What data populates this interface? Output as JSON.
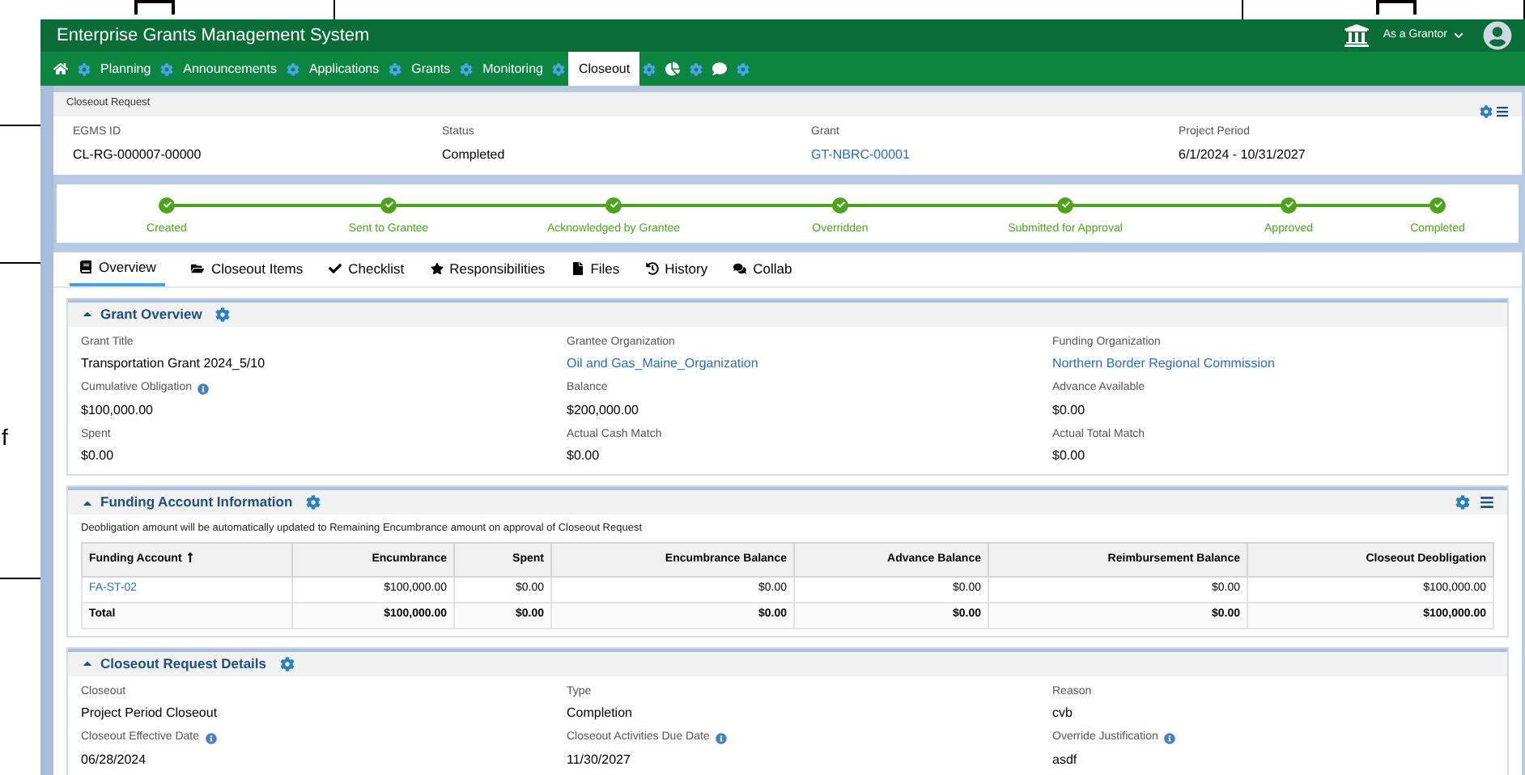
{
  "page_margin": {
    "letter": "f"
  },
  "header": {
    "title": "Enterprise Grants Management System",
    "role_menu": "As a Grantor"
  },
  "nav": [
    {
      "kind": "home"
    },
    {
      "kind": "tab",
      "label": "Planning",
      "selected": false
    },
    {
      "kind": "tab",
      "label": "Announcements",
      "selected": false
    },
    {
      "kind": "tab",
      "label": "Applications",
      "selected": false
    },
    {
      "kind": "tab",
      "label": "Grants",
      "selected": false
    },
    {
      "kind": "tab",
      "label": "Monitoring",
      "selected": false
    },
    {
      "kind": "tab",
      "label": "Closeout",
      "selected": true
    },
    {
      "kind": "chart"
    },
    {
      "kind": "chat"
    }
  ],
  "record": {
    "title": "Closeout Request",
    "fields": [
      {
        "label": "EGMS ID",
        "value": "CL-RG-000007-00000",
        "link": false
      },
      {
        "label": "Status",
        "value": "Completed",
        "link": false
      },
      {
        "label": "Grant",
        "value": "GT-NBRC-00001",
        "link": true
      },
      {
        "label": "Project Period",
        "value": "6/1/2024 - 10/31/2027",
        "link": false
      }
    ]
  },
  "steps": [
    {
      "label": "Created",
      "done": true
    },
    {
      "label": "Sent to Grantee",
      "done": true
    },
    {
      "label": "Acknowledged by Grantee",
      "done": true
    },
    {
      "label": "Overridden",
      "done": true
    },
    {
      "label": "Submitted for Approval",
      "done": true
    },
    {
      "label": "Approved",
      "done": true
    },
    {
      "label": "Completed",
      "done": true
    }
  ],
  "tabs": [
    {
      "label": "Overview",
      "selected": true
    },
    {
      "label": "Closeout Items",
      "selected": false
    },
    {
      "label": "Checklist",
      "selected": false
    },
    {
      "label": "Responsibilities",
      "selected": false
    },
    {
      "label": "Files",
      "selected": false
    },
    {
      "label": "History",
      "selected": false
    },
    {
      "label": "Collab",
      "selected": false
    }
  ],
  "grant_overview": {
    "title": "Grant Overview",
    "fields": [
      {
        "label": "Grant Title",
        "value": "Transportation Grant 2024_5/10",
        "link": false,
        "info": false
      },
      {
        "label": "Grantee Organization",
        "value": "Oil and Gas_Maine_Organization",
        "link": true,
        "info": false
      },
      {
        "label": "Funding Organization",
        "value": "Northern Border Regional Commission",
        "link": true,
        "info": false
      },
      {
        "label": "Cumulative Obligation",
        "value": "$100,000.00",
        "link": false,
        "info": true
      },
      {
        "label": "Balance",
        "value": "$200,000.00",
        "link": false,
        "info": false
      },
      {
        "label": "Advance Available",
        "value": "$0.00",
        "link": false,
        "info": false
      },
      {
        "label": "Spent",
        "value": "$0.00",
        "link": false,
        "info": false
      },
      {
        "label": "Actual Cash Match",
        "value": "$0.00",
        "link": false,
        "info": false
      },
      {
        "label": "Actual Total Match",
        "value": "$0.00",
        "link": false,
        "info": false
      }
    ]
  },
  "funding": {
    "title": "Funding Account Information",
    "note": "Deobligation amount will be automatically updated to Remaining Encumbrance amount on approval of Closeout Request",
    "columns": [
      "Funding Account",
      "Encumbrance",
      "Spent",
      "Encumbrance Balance",
      "Advance Balance",
      "Reimbursement Balance",
      "Closeout Deobligation"
    ],
    "rows": [
      {
        "kind": "item",
        "cells": [
          "FA-ST-02",
          "$100,000.00",
          "$0.00",
          "$0.00",
          "$0.00",
          "$0.00",
          "$100,000.00"
        ]
      },
      {
        "kind": "total",
        "cells": [
          "Total",
          "$100,000.00",
          "$0.00",
          "$0.00",
          "$0.00",
          "$0.00",
          "$100,000.00"
        ]
      }
    ]
  },
  "details": {
    "title": "Closeout Request Details",
    "fields": [
      {
        "label": "Closeout",
        "value": "Project Period Closeout",
        "link": false,
        "info": false
      },
      {
        "label": "Type",
        "value": "Completion",
        "link": false,
        "info": false
      },
      {
        "label": "Reason",
        "value": "cvb",
        "link": false,
        "info": false
      },
      {
        "label": "Closeout Effective Date",
        "value": "06/28/2024",
        "link": false,
        "info": true
      },
      {
        "label": "Closeout Activities Due Date",
        "value": "11/30/2027",
        "link": false,
        "info": true
      },
      {
        "label": "Override Justification",
        "value": "asdf",
        "link": false,
        "info": true
      }
    ]
  }
}
